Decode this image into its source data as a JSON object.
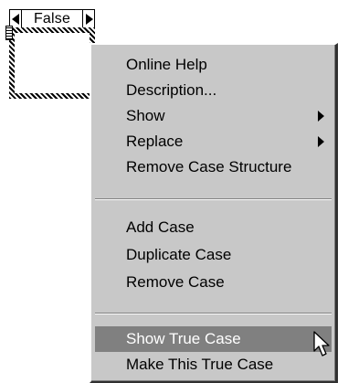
{
  "case_structure": {
    "selector_value": "False",
    "prev_icon": "triangle-left-icon",
    "next_icon": "triangle-right-icon"
  },
  "context_menu": {
    "groups": [
      {
        "items": [
          {
            "label": "Online Help",
            "submenu": false
          },
          {
            "label": "Description...",
            "submenu": false
          },
          {
            "label": "Show",
            "submenu": true
          },
          {
            "label": "Replace",
            "submenu": true
          },
          {
            "label": "Remove Case Structure",
            "submenu": false
          }
        ]
      },
      {
        "items": [
          {
            "label": "Add Case",
            "submenu": false
          },
          {
            "label": "Duplicate Case",
            "submenu": false
          },
          {
            "label": "Remove Case",
            "submenu": false
          }
        ]
      },
      {
        "items": [
          {
            "label": "Show True Case",
            "submenu": false,
            "highlighted": true
          },
          {
            "label": "Make This True Case",
            "submenu": false
          }
        ]
      }
    ]
  },
  "cursor": {
    "icon": "arrow-pointer-icon"
  },
  "colors": {
    "menu_background": "#c8c8c8",
    "highlight": "#808080",
    "highlight_text": "#ffffff"
  }
}
